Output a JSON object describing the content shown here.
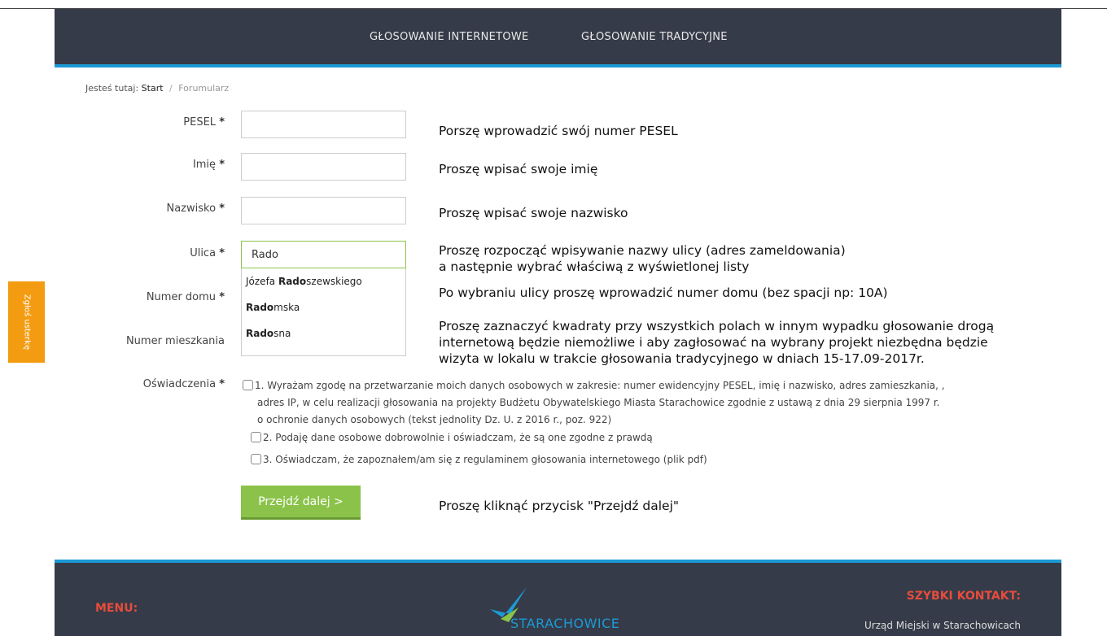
{
  "nav": {
    "items": [
      "GŁOSOWANIE INTERNETOWE",
      "GŁOSOWANIE TRADYCYJNE"
    ]
  },
  "breadcrumb": {
    "prefix": "Jesteś tutaj:",
    "start": "Start",
    "separator": "/",
    "current": "Forumularz"
  },
  "form": {
    "required_marker": "*",
    "pesel": {
      "label": "PESEL",
      "value": "",
      "hint": "Porszę wprowadzić swój numer PESEL"
    },
    "first_name": {
      "label": "Imię",
      "value": "",
      "hint": "Proszę wpisać swoje imię"
    },
    "last_name": {
      "label": "Nazwisko",
      "value": "",
      "hint": "Proszę wpisać swoje nazwisko"
    },
    "street": {
      "label": "Ulica",
      "value": "Rado",
      "hint_line1": "Proszę rozpocząć wpisywanie nazwy ulicy (adres zameldowania)",
      "hint_line2": "a następnie wybrać właściwą z wyświetlonej listy",
      "suggestions": [
        {
          "before": "Józefa ",
          "match": "Rado",
          "after": "szewskiego"
        },
        {
          "before": "",
          "match": "Rado",
          "after": "mska"
        },
        {
          "before": "",
          "match": "Rado",
          "after": "sna"
        }
      ]
    },
    "house_number": {
      "label": "Numer domu",
      "hint": "Po wybraniu ulicy proszę wprowadzić numer domu (bez spacji np: 10A)"
    },
    "apartment_number": {
      "label": "Numer mieszkania",
      "hint_line1": "Proszę zaznaczyć kwadraty przy wszystkich polach w innym wypadku głosowanie drogą",
      "hint_line2": "internetową będzie niemożliwe i aby zagłosować na wybrany projekt niezbędna będzie",
      "hint_line3": "wizyta w lokalu w trakcie głosowania tradycyjnego w dniach 15-17.09-2017r."
    },
    "declarations": {
      "label": "Oświadczenia",
      "item1_line1": "1. Wyrażam zgodę na przetwarzanie moich danych osobowych w zakresie: numer ewidencyjny PESEL, imię i nazwisko, adres zamieszkania, ,",
      "item1_line2": "adres IP, w celu realizacji głosowania na projekty Budżetu Obywatelskiego Miasta Starachowice zgodnie z ustawą z dnia 29 sierpnia 1997 r.",
      "item1_line3": "o ochronie danych osobowych (tekst jednolity Dz. U. z 2016 r., poz. 922)",
      "item2": "2. Podaję dane osobowe dobrowolnie i oświadczam, że są one zgodne z prawdą",
      "item3": "3. Oświadczam, że zapoznałem/am się z regulaminem głosowania internetowego (plik pdf)"
    },
    "submit_label": "Przejdź dalej >",
    "submit_hint": "Proszę kliknąć przycisk \"Przejdź dalej\""
  },
  "side_tab": {
    "label": "Zgłoś usterkę"
  },
  "footer": {
    "menu_title": "MENU:",
    "logo_text": "STARACHOWICE",
    "contact_title": "SZYBKI KONTAKT:",
    "contact_line": "Urząd Miejski w Starachowicach"
  },
  "colors": {
    "nav_bg": "#353b48",
    "accent_blue": "#1c9ad6",
    "button_green": "#8bc34a",
    "side_tab_orange": "#f39c12",
    "footer_red": "#e74c3c"
  }
}
